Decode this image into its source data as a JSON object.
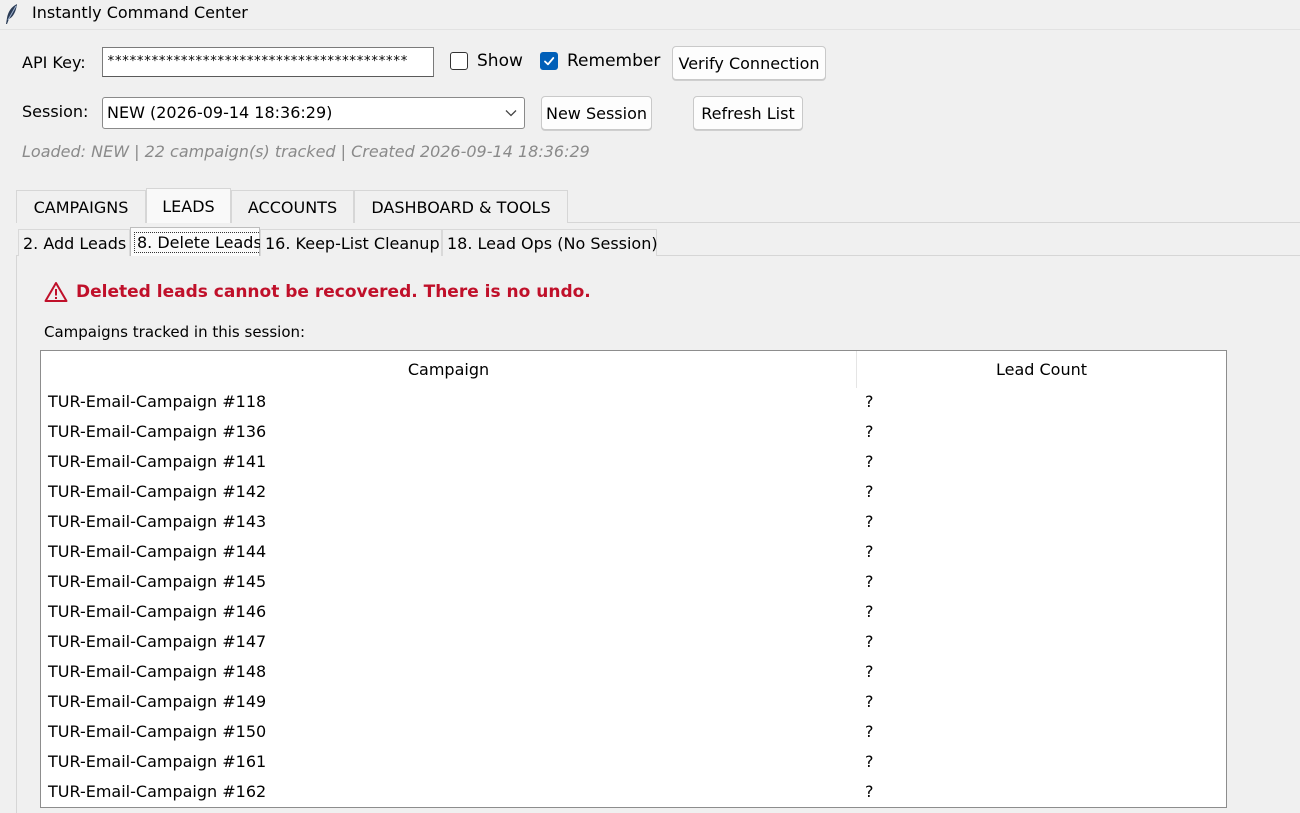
{
  "window": {
    "title": "Instantly Command Center"
  },
  "api": {
    "label": "API Key:",
    "value": "*****************************************",
    "show_label": "Show",
    "show_checked": false,
    "remember_label": "Remember",
    "remember_checked": true,
    "verify_label": "Verify Connection"
  },
  "session": {
    "label": "Session:",
    "selected": "NEW  (2026-09-14 18:36:29)",
    "new_label": "New Session",
    "refresh_label": "Refresh List",
    "status": "Loaded: NEW  |  22 campaign(s) tracked  |  Created 2026-09-14 18:36:29"
  },
  "tabs": [
    {
      "label": "CAMPAIGNS",
      "active": false
    },
    {
      "label": "LEADS",
      "active": true
    },
    {
      "label": "ACCOUNTS",
      "active": false
    },
    {
      "label": "DASHBOARD & TOOLS",
      "active": false
    }
  ],
  "subtabs": [
    {
      "label": "2. Add Leads",
      "active": false
    },
    {
      "label": "8. Delete Leads",
      "active": true
    },
    {
      "label": "16. Keep-List Cleanup",
      "active": false
    },
    {
      "label": "18. Lead Ops (No Session)",
      "active": false
    }
  ],
  "warning": {
    "text": "Deleted leads cannot be recovered. There is no undo.",
    "color": "#c0102a"
  },
  "tracked_label": "Campaigns tracked in this session:",
  "table": {
    "columns": [
      "Campaign",
      "Lead Count"
    ],
    "rows": [
      [
        "TUR-Email-Campaign #118",
        "?"
      ],
      [
        "TUR-Email-Campaign #136",
        "?"
      ],
      [
        "TUR-Email-Campaign #141",
        "?"
      ],
      [
        "TUR-Email-Campaign #142",
        "?"
      ],
      [
        "TUR-Email-Campaign #143",
        "?"
      ],
      [
        "TUR-Email-Campaign #144",
        "?"
      ],
      [
        "TUR-Email-Campaign #145",
        "?"
      ],
      [
        "TUR-Email-Campaign #146",
        "?"
      ],
      [
        "TUR-Email-Campaign #147",
        "?"
      ],
      [
        "TUR-Email-Campaign #148",
        "?"
      ],
      [
        "TUR-Email-Campaign #149",
        "?"
      ],
      [
        "TUR-Email-Campaign #150",
        "?"
      ],
      [
        "TUR-Email-Campaign #161",
        "?"
      ],
      [
        "TUR-Email-Campaign #162",
        "?"
      ]
    ]
  },
  "icons": {
    "app": "feather-icon",
    "warning": "warning-triangle-icon",
    "combo": "chevron-down-icon",
    "check": "checkmark-icon"
  },
  "colors": {
    "accent": "#005fb8",
    "background": "#f0f0f0"
  }
}
